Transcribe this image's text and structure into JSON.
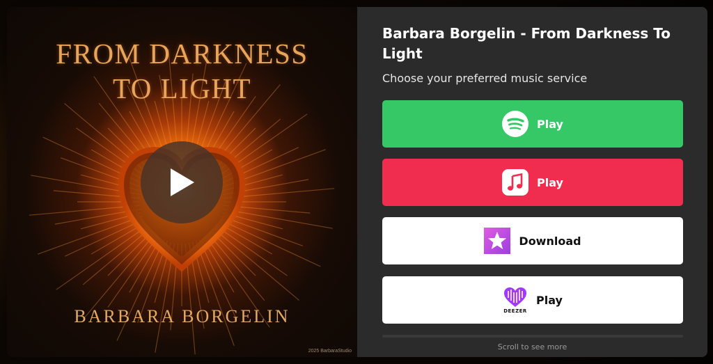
{
  "album": {
    "title_line1": "FROM DARKNESS",
    "title_line2": "TO LIGHT",
    "artist": "BARBARA BORGELIN",
    "copyright": "2025 BarbaraStudio"
  },
  "panel": {
    "title": "Barbara Borgelin - From Darkness To Light",
    "subtitle": "Choose your preferred music service",
    "scroll_hint": "Scroll to see more"
  },
  "services": [
    {
      "name": "spotify",
      "label": "Play",
      "icon": "spotify-icon",
      "color": "#36c866"
    },
    {
      "name": "apple-music",
      "label": "Play",
      "icon": "apple-music-icon",
      "color": "#f02c4f"
    },
    {
      "name": "itunes-store",
      "label": "Download",
      "icon": "itunes-star-icon",
      "color": "#ffffff"
    },
    {
      "name": "deezer",
      "label": "Play",
      "icon": "deezer-icon",
      "color": "#ffffff",
      "wordmark": "DEEZER"
    }
  ]
}
